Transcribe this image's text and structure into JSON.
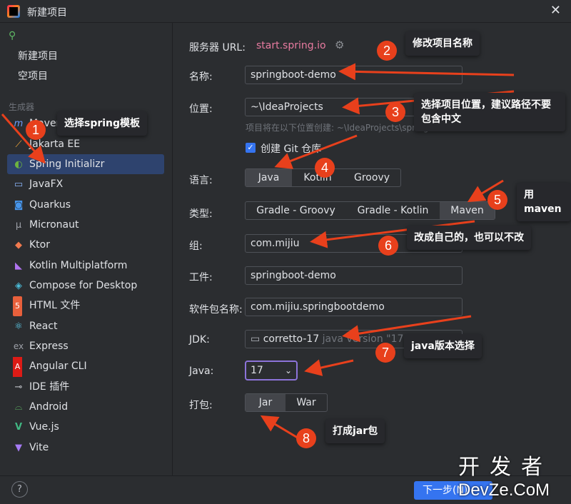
{
  "window": {
    "title": "新建项目",
    "close": "✕"
  },
  "sidebar": {
    "top_items": [
      "新建项目",
      "空项目"
    ],
    "section": "生成器",
    "generators": [
      {
        "label": "Maven Archetype",
        "icon": "m",
        "color": "#6b9bfa"
      },
      {
        "label": "Jakarta EE",
        "icon": "⟋",
        "color": "#f3a83b"
      },
      {
        "label": "Spring Initializr",
        "icon": "◐",
        "color": "#6db33f"
      },
      {
        "label": "JavaFX",
        "icon": "▭",
        "color": "#8ab4f8"
      },
      {
        "label": "Quarkus",
        "icon": "◙",
        "color": "#4695eb"
      },
      {
        "label": "Micronaut",
        "icon": "μ",
        "color": "#9da0a8"
      },
      {
        "label": "Ktor",
        "icon": "◆",
        "color": "#f17a4f"
      },
      {
        "label": "Kotlin Multiplatform",
        "icon": "◣",
        "color": "#b074f0"
      },
      {
        "label": "Compose for Desktop",
        "icon": "◈",
        "color": "#4bbcd8"
      },
      {
        "label": "HTML 文件",
        "icon": "5",
        "color": "#e8603c"
      },
      {
        "label": "React",
        "icon": "⚛",
        "color": "#5fd3f3"
      },
      {
        "label": "Express",
        "icon": "ex",
        "color": "#9da0a8"
      },
      {
        "label": "Angular CLI",
        "icon": "A",
        "color": "#dd1b16"
      },
      {
        "label": "IDE 插件",
        "icon": "⊸",
        "color": "#c9ccd1"
      },
      {
        "label": "Android",
        "icon": "⌓",
        "color": "#5fb865"
      },
      {
        "label": "Vue.js",
        "icon": "V",
        "color": "#41b883"
      },
      {
        "label": "Vite",
        "icon": "▼",
        "color": "#a67bf5"
      }
    ]
  },
  "form": {
    "server_url_label": "服务器 URL:",
    "server_url": "start.spring.io",
    "name_label": "名称:",
    "name_value": "springboot-demo",
    "location_label": "位置:",
    "location_value": "~\\IdeaProjects",
    "location_hint": "项目将在以下位置创建: ~\\IdeaProjects\\springboot-demo",
    "git_label": "创建 Git 仓库",
    "language_label": "语言:",
    "languages": [
      "Java",
      "Kotlin",
      "Groovy"
    ],
    "type_label": "类型:",
    "types": [
      "Gradle - Groovy",
      "Gradle - Kotlin",
      "Maven"
    ],
    "group_label": "组:",
    "group_value": "com.mijiu",
    "artifact_label": "工件:",
    "artifact_value": "springboot-demo",
    "package_label": "软件包名称:",
    "package_value": "com.mijiu.springbootdemo",
    "jdk_label": "JDK:",
    "jdk_value": "corretto-17",
    "jdk_version": "java version \"17.0.9\"",
    "java_label": "Java:",
    "java_value": "17",
    "packaging_label": "打包:",
    "packagings": [
      "Jar",
      "War"
    ]
  },
  "footer": {
    "help": "?",
    "next": "下一步(N)"
  },
  "annotations": {
    "badges": [
      "1",
      "2",
      "3",
      "4",
      "5",
      "6",
      "7",
      "8"
    ],
    "callouts": {
      "c1": "选择spring模板",
      "c2": "修改项目名称",
      "c3": "选择项目位置，建议路径不要包含中文",
      "c5": "用maven",
      "c6": "改成自己的，也可以不改",
      "c7": "java版本选择",
      "c8": "打成jar包"
    },
    "arrow_color": "#e8401c"
  },
  "watermark": {
    "top": "开发者",
    "bottom": "DevZe.CoM"
  }
}
